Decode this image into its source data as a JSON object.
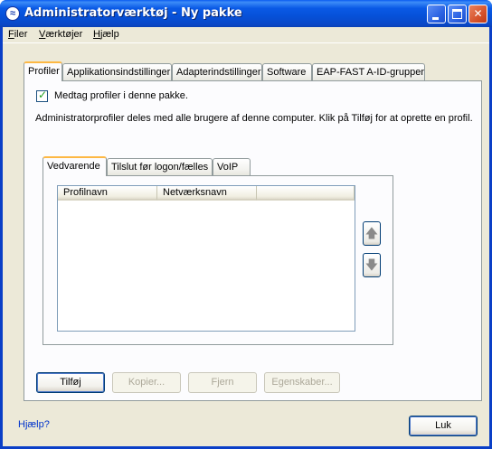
{
  "window": {
    "title": "Administratorværktøj - Ny pakke",
    "minimize_icon": "minimize-icon",
    "maximize_icon": "maximize-icon",
    "close_icon": "close-icon"
  },
  "menu": {
    "items": [
      {
        "label": "Filer",
        "accel": "F"
      },
      {
        "label": "Værktøjer",
        "accel": "V"
      },
      {
        "label": "Hjælp",
        "accel": "H"
      }
    ]
  },
  "main_tabs": [
    {
      "label": "Profiler",
      "active": true
    },
    {
      "label": "Applikationsindstillinger",
      "active": false
    },
    {
      "label": "Adapterindstillinger",
      "active": false
    },
    {
      "label": "Software",
      "active": false
    },
    {
      "label": "EAP-FAST A-ID-grupper",
      "active": false
    }
  ],
  "profiles": {
    "include_checkbox": {
      "label": "Medtag profiler i denne pakke.",
      "checked": true
    },
    "description": "Administratorprofiler deles med alle brugere af denne computer. Klik på Tilføj for at oprette en profil.",
    "sub_tabs": [
      {
        "label": "Vedvarende",
        "active": true
      },
      {
        "label": "Tilslut før logon/fælles",
        "active": false
      },
      {
        "label": "VoIP",
        "active": false
      }
    ],
    "columns": [
      "Profilnavn",
      "Netværksnavn",
      ""
    ],
    "rows": [],
    "move_up_icon": "arrow-up-icon",
    "move_down_icon": "arrow-down-icon"
  },
  "buttons": {
    "add": "Tilføj",
    "copy": "Kopier...",
    "remove": "Fjern",
    "properties": "Egenskaber...",
    "close": "Luk"
  },
  "help_link": "Hjælp?",
  "colors": {
    "titlebar": "#0a5ae6",
    "window_bg": "#ece9d8",
    "active_tab_highlight": "#fdb844",
    "link": "#0033cc"
  }
}
